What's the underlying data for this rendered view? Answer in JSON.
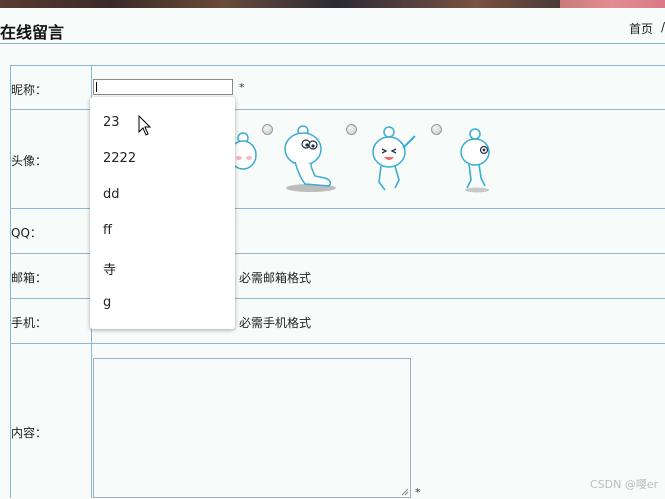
{
  "header": {
    "title": "在线留言",
    "breadcrumb_home": "首页",
    "breadcrumb_sep": "/"
  },
  "form": {
    "nickname_label": "昵称：",
    "nickname_value": "",
    "required_mark": "*",
    "avatar_label": "头像：",
    "qq_label": "QQ：",
    "email_label": "邮箱：",
    "email_hint": "必需邮箱格式",
    "phone_label": "手机：",
    "phone_hint": "必需手机格式",
    "content_label": "内容："
  },
  "autocomplete": {
    "options": [
      "23",
      "2222",
      "dd",
      "ff",
      "寺",
      "g"
    ]
  },
  "watermark": "CSDN @嘤er",
  "colors": {
    "border": "#8fb7d4",
    "page_bg": "#f7fcfa",
    "avatar_blue": "#3aaed0"
  }
}
